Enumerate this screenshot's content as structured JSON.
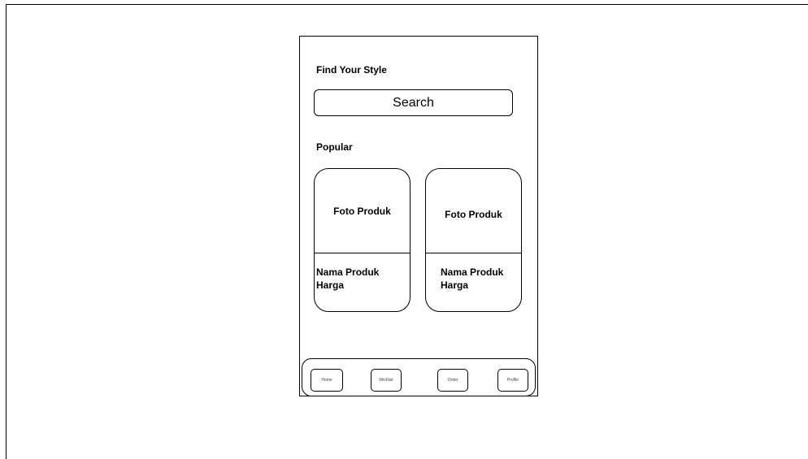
{
  "header": {
    "title": "Find Your Style"
  },
  "search": {
    "label": "Search"
  },
  "popular": {
    "heading": "Popular",
    "cards": [
      {
        "photo": "Foto Produk",
        "name": "Nama Produk",
        "price": "Harga"
      },
      {
        "photo": "Foto Produk",
        "name": "Nama Produk",
        "price": "Harga"
      }
    ]
  },
  "bottom_nav": {
    "items": [
      "Home",
      "Wishlist",
      "Order",
      "Profile"
    ]
  }
}
